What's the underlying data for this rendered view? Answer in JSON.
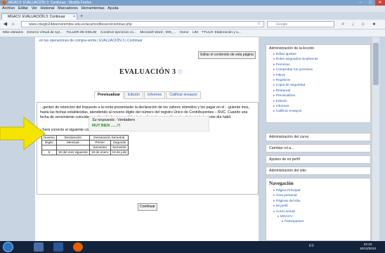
{
  "window": {
    "title": "MGACV: EVALUACIÓN 3: Continuar - Mozilla Firefox",
    "controls": [
      "–",
      "□",
      "✕"
    ]
  },
  "menu": [
    "Archivo",
    "Editar",
    "Ver",
    "Historial",
    "Marcadores",
    "Herramientas",
    "Ayuda"
  ],
  "tab": {
    "label": "MGACV: EVALUACIÓN 3: Continuar",
    "close": "×",
    "new": "+"
  },
  "url": "www.colegio24deenvirembre.edu.ec/aca/mod/lesson/continue.php",
  "search_placeholder": "Google",
  "bookmarks": [
    "Más visitados",
    "Entorno Virtual de Apr...",
    "TALLER DE EDILIM",
    "Construir ejercicios co...",
    "Microsoft Word - 006_...",
    "Home",
    "LIM",
    "TTULO: Elaboración y a..."
  ],
  "breadcrumb": "en las operaciones de compra-venta | EVALUACIÓN 3 | Continuar",
  "edit_button": "Editar el contenido de esta página",
  "page_heading": "EVALUACIÓN 3",
  "heading_icon": "help-icon",
  "tabs": [
    "Previsualizar",
    "Edición",
    "Informes",
    "Calificar ensayos"
  ],
  "question_text": "...gentes de retención del Impuesto a la renta presentarán la declaración de los valores retenidos y los pagar en el ...guiente mes, hasta las fechas establecidas, atendiendo al noveno dígito del número del registro Único de Contribuyentes – RUC. Cuando una fecha de vencimiento coincida con días de descanso obligatorio o feriados, aquella se trasladará al siguiente día hábil.",
  "question": "¿Será correcto el siguiente cálculo de declaración:",
  "table": {
    "headers": [
      [
        "Noveno",
        "Declaración",
        "Declaración Semetral"
      ],
      [
        "Dígito",
        "Mensual",
        "Primer",
        "Segundo"
      ],
      [
        "",
        "",
        "Semestre",
        "Semestre"
      ]
    ],
    "row": [
      "6",
      "18 del mes siguiente",
      "18 de enero",
      "18 de julio"
    ]
  },
  "answer": {
    "label": "Su respuesta :",
    "value": "Verdadero",
    "feedback": "MUY BIEN ......!!!"
  },
  "continue_button": "Continuar",
  "sidebar_admin_lesson": {
    "title": "Administración de la lección",
    "items": [
      "Editar ajustes",
      "Roles asignados localmente",
      "Permisos",
      "Comprobar los permisos",
      "Filtros",
      "Registros",
      "Copia de seguridad",
      "Restaurar",
      "Previsualizar",
      "Edición",
      "Informes",
      "Calificar ensayos"
    ]
  },
  "sidebar_blocks": [
    "Administración del curso",
    "Cambiar rol a...",
    "Ajustes de mi perfil",
    "Administración del sitio"
  ],
  "navigation": {
    "title": "Navegación",
    "items": [
      "Página Principal",
      "Área personal",
      "Páginas del sitio",
      "Mi perfil",
      "Curso actual",
      "MGACV",
      "Participantes"
    ]
  },
  "clock": {
    "time": "22:10",
    "date": "10/12/2013"
  },
  "tray": "ES",
  "colors": {
    "arrow": "#f5e400",
    "link": "#2a5aa8",
    "feedback": "#1a9a1a",
    "taskbar": "#14233c"
  }
}
